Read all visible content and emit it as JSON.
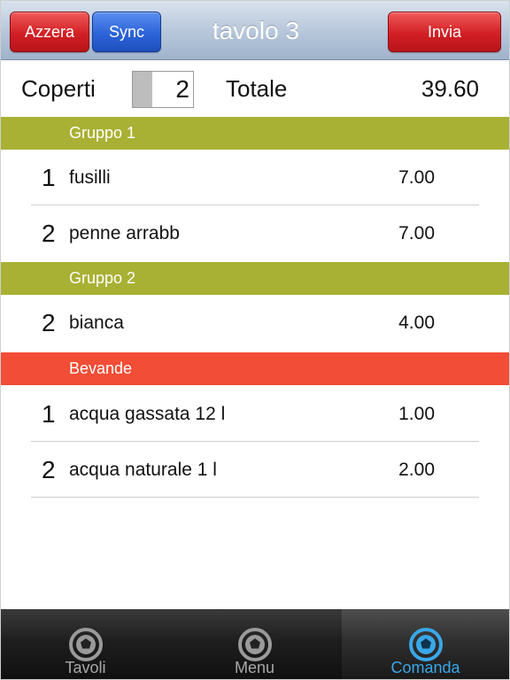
{
  "header": {
    "title": "tavolo 3",
    "reset_label": "Azzera",
    "sync_label": "Sync",
    "send_label": "Invia"
  },
  "summary": {
    "covers_label": "Coperti",
    "covers_value": "2",
    "total_label": "Totale",
    "total_value": "39.60"
  },
  "groups": [
    {
      "name": "Gruppo 1",
      "color": "#a9b134",
      "items": [
        {
          "qty": "1",
          "name": "fusilli",
          "price": "7.00"
        },
        {
          "qty": "2",
          "name": "penne arrabb",
          "price": "7.00"
        }
      ]
    },
    {
      "name": "Gruppo 2",
      "color": "#a9b134",
      "items": [
        {
          "qty": "2",
          "name": "bianca",
          "price": "4.00"
        }
      ]
    },
    {
      "name": "Bevande",
      "color": "#f24d36",
      "items": [
        {
          "qty": "1",
          "name": "acqua gassata 12 l",
          "price": "1.00"
        },
        {
          "qty": "2",
          "name": "acqua naturale 1 l",
          "price": "2.00"
        }
      ]
    }
  ],
  "tabs": [
    {
      "label": "Tavoli",
      "icon": "soccer-ball-icon",
      "active": false
    },
    {
      "label": "Menu",
      "icon": "soccer-ball-icon",
      "active": false
    },
    {
      "label": "Comanda",
      "icon": "soccer-ball-icon",
      "active": true
    }
  ],
  "colors": {
    "accent_red": "#d21f25",
    "accent_blue": "#2c63d8",
    "active_tab": "#3aa7e8"
  }
}
